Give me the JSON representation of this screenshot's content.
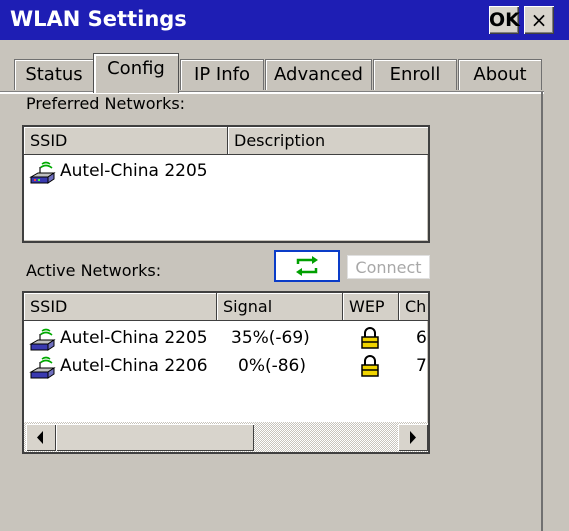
{
  "window": {
    "title": "WLAN Settings",
    "ok_label": "OK",
    "close_label": "×"
  },
  "tabs": [
    {
      "label": "Status",
      "active": false
    },
    {
      "label": "Config",
      "active": true
    },
    {
      "label": "IP Info",
      "active": false
    },
    {
      "label": "Advanced",
      "active": false
    },
    {
      "label": "Enroll",
      "active": false
    },
    {
      "label": "About",
      "active": false
    }
  ],
  "preferred": {
    "label": "Preferred Networks:",
    "columns": [
      "SSID",
      "Description"
    ],
    "rows": [
      {
        "ssid": "Autel-China 2205",
        "description": "",
        "icon": "network-icon"
      }
    ]
  },
  "active": {
    "label": "Active Networks:",
    "refresh_icon": "refresh-icon",
    "connect_label": "Connect",
    "columns": [
      "SSID",
      "Signal",
      "WEP",
      "Ch"
    ],
    "rows": [
      {
        "ssid": "Autel-China 2205",
        "signal": "35%(-69)",
        "wep": "lock-icon",
        "ch": "6",
        "icon": "network-icon"
      },
      {
        "ssid": "Autel-China 2206",
        "signal": "0%(-86)",
        "wep": "lock-icon",
        "ch": "7",
        "icon": "network-icon"
      }
    ],
    "scroll_position": 0.0
  },
  "colors": {
    "titlebar": "#1e1eb4",
    "refresh_border": "#0a3cc8",
    "refresh_arrows": "#00a000",
    "lock": "#e8c800"
  }
}
